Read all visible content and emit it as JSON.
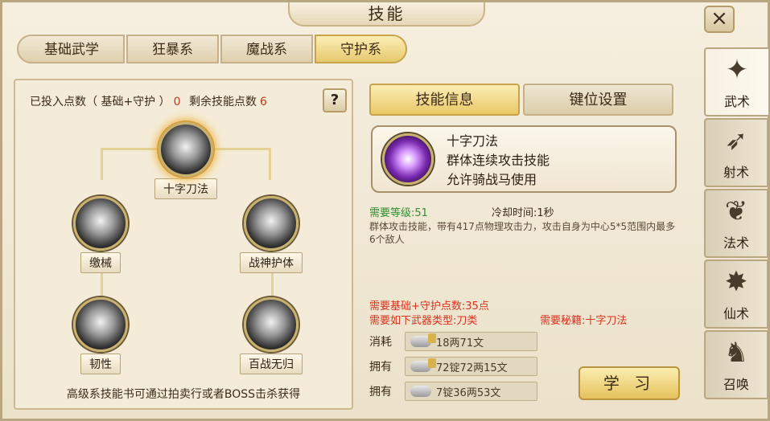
{
  "window": {
    "title": "技能",
    "close_icon": "×"
  },
  "top_tabs": [
    {
      "label": "基础武学"
    },
    {
      "label": "狂暴系"
    },
    {
      "label": "魔战系"
    },
    {
      "label": "守护系",
      "active": true
    }
  ],
  "tree": {
    "invested_label": "已投入点数（ 基础+守护 ）",
    "invested_value": "0",
    "remaining_label": "剩余技能点数",
    "remaining_value": "6",
    "help_label": "?",
    "skills": [
      {
        "name": "十字刀法"
      },
      {
        "name": "缴械"
      },
      {
        "name": "战神护体"
      },
      {
        "name": "韧性"
      },
      {
        "name": "百战无归"
      }
    ],
    "note": "高级系技能书可通过拍卖行或者BOSS击杀获得"
  },
  "detail": {
    "tabs": [
      {
        "label": "技能信息",
        "active": true
      },
      {
        "label": "键位设置"
      }
    ],
    "card": {
      "name": "十字刀法",
      "line2": "群体连续攻击技能",
      "line3": "允许骑战马使用"
    },
    "required_level": "需要等级:51",
    "cooldown": "冷却时间:1秒",
    "description": "群体攻击技能，带有417点物理攻击力，攻击自身为中心5*5范围内最多6个敌人",
    "req_points": "需要基础+守护点数:35点",
    "req_weapon": "需要如下武器类型:刀类",
    "req_book": "需要秘籍:十字刀法",
    "costs": [
      {
        "label": "消耗",
        "value": "18两71文"
      },
      {
        "label": "拥有",
        "value": "72锭72两15文"
      },
      {
        "label": "拥有",
        "value": "7锭36两53文"
      }
    ],
    "learn_label": "学 习"
  },
  "side_tabs": [
    {
      "label": "武术",
      "icon": "martial-arts-icon",
      "glyph": "✦",
      "active": true
    },
    {
      "label": "射术",
      "icon": "archery-icon",
      "glyph": "➶"
    },
    {
      "label": "法术",
      "icon": "gourd-icon",
      "glyph": "❦"
    },
    {
      "label": "仙术",
      "icon": "shuriken-icon",
      "glyph": "✸"
    },
    {
      "label": "召唤",
      "icon": "beast-icon",
      "glyph": "♞"
    }
  ]
}
